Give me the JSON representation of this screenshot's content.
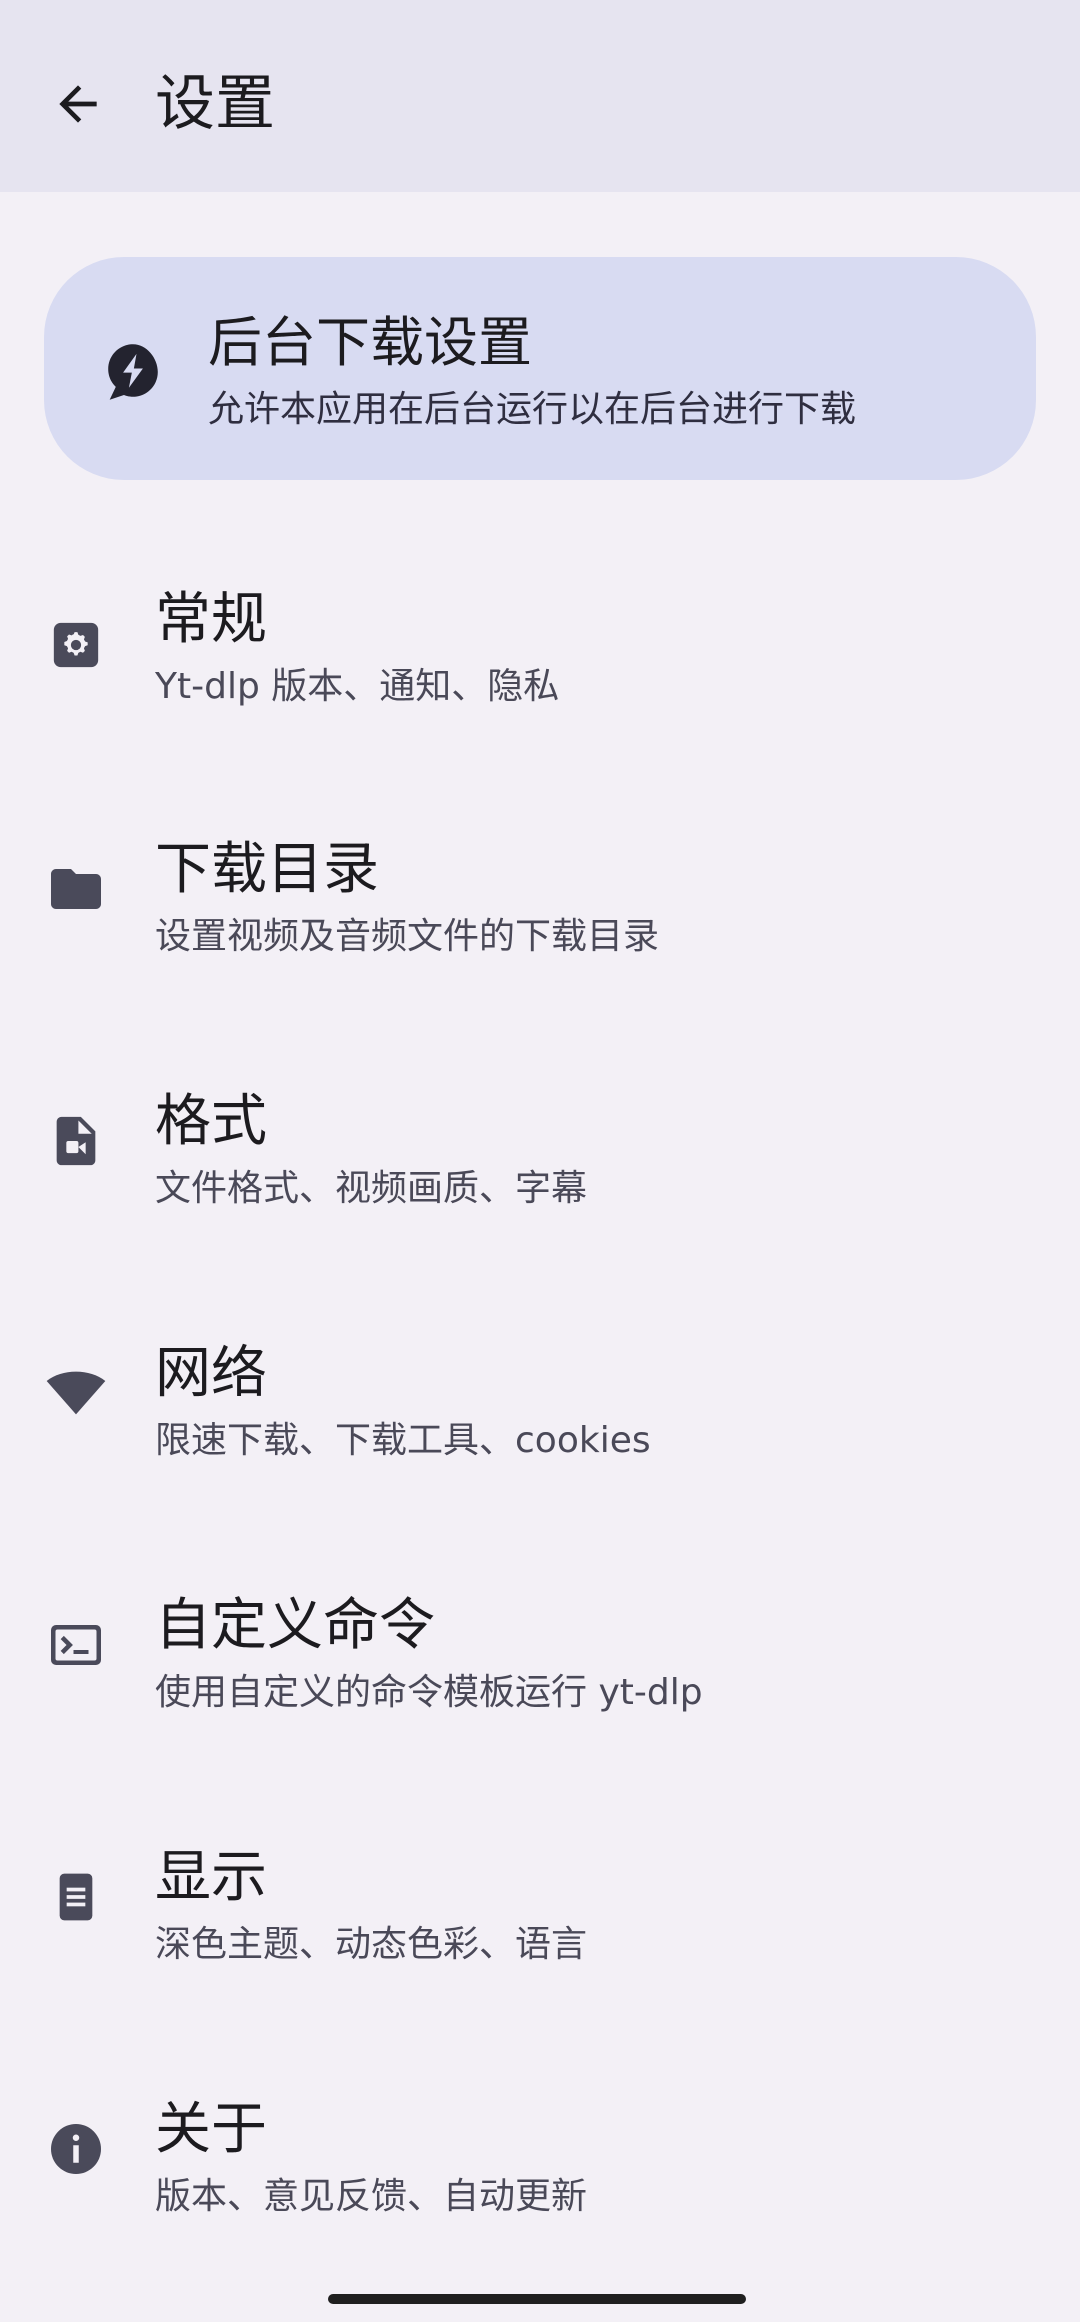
{
  "header": {
    "title": "设置",
    "back_icon": "arrow-back-icon"
  },
  "banner": {
    "title": "后台下载设置",
    "subtitle": "允许本应用在后台运行以在后台进行下载",
    "icon": "battery-bolt-icon",
    "color": "#d8dbf2"
  },
  "items": [
    {
      "title": "常规",
      "subtitle": "Yt-dlp 版本、通知、隐私",
      "icon": "gear-icon"
    },
    {
      "title": "下载目录",
      "subtitle": "设置视频及音频文件的下载目录",
      "icon": "folder-icon"
    },
    {
      "title": "格式",
      "subtitle": "文件格式、视频画质、字幕",
      "icon": "video-file-icon"
    },
    {
      "title": "网络",
      "subtitle": "限速下载、下载工具、cookies",
      "icon": "wifi-icon"
    },
    {
      "title": "自定义命令",
      "subtitle": "使用自定义的命令模板运行 yt-dlp",
      "icon": "terminal-icon"
    },
    {
      "title": "显示",
      "subtitle": "深色主题、动态色彩、语言",
      "icon": "document-icon"
    },
    {
      "title": "关于",
      "subtitle": "版本、意见反馈、自动更新",
      "icon": "info-icon"
    }
  ],
  "colors": {
    "background": "#f3f0f6",
    "topbar": "#e6e4f0",
    "icon": "#4a4a5a"
  }
}
